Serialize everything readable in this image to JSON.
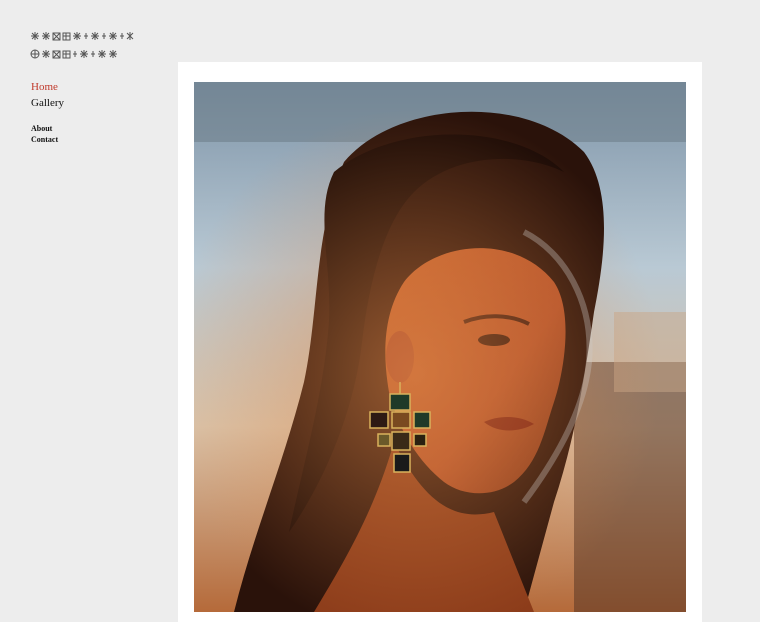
{
  "site": {
    "logo_icon": "ornamental-wordmark-logo"
  },
  "nav": {
    "primary": [
      {
        "label": "Home",
        "active": true
      },
      {
        "label": "Gallery",
        "active": false
      }
    ],
    "secondary": [
      {
        "label": "About"
      },
      {
        "label": "Contact"
      }
    ]
  },
  "colors": {
    "background": "#ededed",
    "active_link": "#c0392b",
    "link": "#111111",
    "frame": "#ffffff"
  },
  "featured_image": {
    "icon": "portrait-photo"
  }
}
